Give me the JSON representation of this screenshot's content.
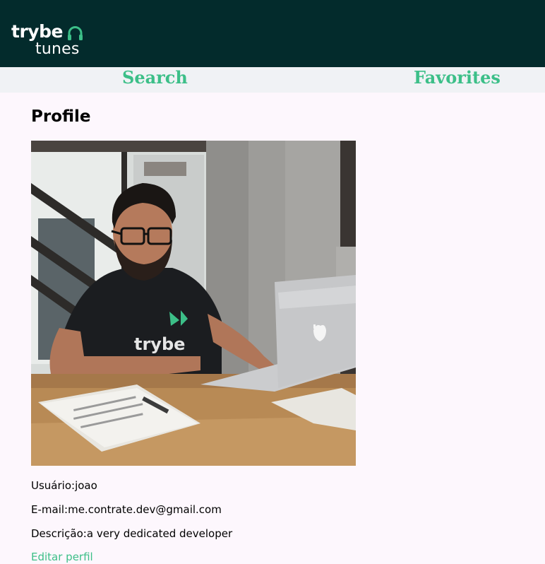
{
  "header": {
    "logo_top": "trybe",
    "logo_bottom": "tunes",
    "logo_icon": "headphones-icon"
  },
  "nav": {
    "search_label": "Search",
    "favorites_label": "Favorites"
  },
  "profile": {
    "title": "Profile",
    "photo_shirt_text": "trybe",
    "user_label": "Usuário:",
    "user_value": "joao",
    "email_label": "E-mail:",
    "email_value": "me.contrate.dev@gmail.com",
    "description_label": "Descrição:",
    "description_value": "a very dedicated developer",
    "edit_link": "Editar perfil"
  },
  "colors": {
    "header_bg": "#032b2c",
    "accent": "#3cbf88",
    "nav_bg": "#f0f2f5",
    "page_bg": "#fdf7fd"
  }
}
